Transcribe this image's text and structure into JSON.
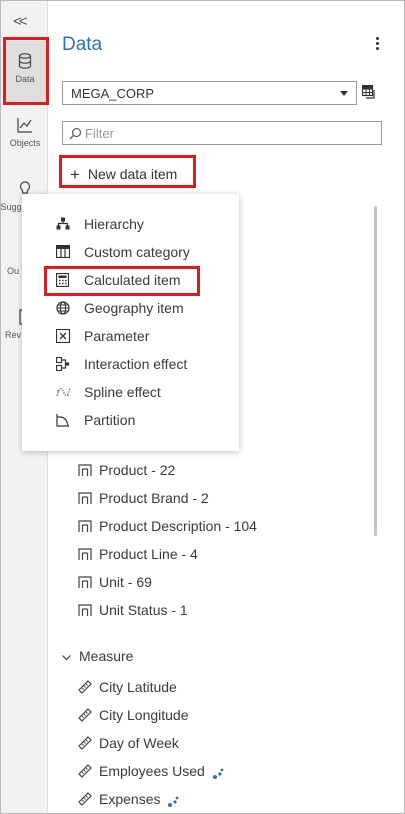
{
  "rail": {
    "collapse_label": "<<",
    "items": [
      {
        "label": "Data",
        "icon": "database-icon",
        "active": true
      },
      {
        "label": "Objects",
        "icon": "line-chart-icon"
      },
      {
        "label": "Sugg",
        "icon": "lightbulb-icon"
      },
      {
        "label": "Ou",
        "icon": "outline-icon"
      },
      {
        "label": "Rev",
        "icon": "report-icon"
      }
    ]
  },
  "header": {
    "title": "Data",
    "menu_icon": "kebab-menu-icon"
  },
  "datasource": {
    "value": "MEGA_CORP",
    "table_icon": "data-table-icon"
  },
  "filter": {
    "placeholder": "Filter"
  },
  "new_data_item": {
    "label": "New data item"
  },
  "menu": {
    "items": [
      {
        "label": "Hierarchy",
        "icon": "hierarchy-icon"
      },
      {
        "label": "Custom category",
        "icon": "custom-category-icon"
      },
      {
        "label": "Calculated item",
        "icon": "calculator-icon"
      },
      {
        "label": "Geography item",
        "icon": "globe-icon"
      },
      {
        "label": "Parameter",
        "icon": "parameter-icon"
      },
      {
        "label": "Interaction effect",
        "icon": "interaction-effect-icon"
      },
      {
        "label": "Spline effect",
        "icon": "spline-effect-icon"
      },
      {
        "label": "Partition",
        "icon": "partition-icon"
      }
    ]
  },
  "categories": [
    {
      "label": "Product - 22"
    },
    {
      "label": "Product Brand - 2"
    },
    {
      "label": "Product Description - 104"
    },
    {
      "label": "Product Line - 4"
    },
    {
      "label": "Unit - 69"
    },
    {
      "label": "Unit Status - 1"
    }
  ],
  "measure_section": {
    "label": "Measure"
  },
  "measures": [
    {
      "label": "City Latitude",
      "derived": false
    },
    {
      "label": "City Longitude",
      "derived": false
    },
    {
      "label": "Day of Week",
      "derived": false
    },
    {
      "label": "Employees Used",
      "derived": true
    },
    {
      "label": "Expenses",
      "derived": true
    }
  ],
  "colors": {
    "accent": "#2f72b8",
    "highlight": "#e01b1b",
    "derived_dots": "#2f72b8"
  }
}
